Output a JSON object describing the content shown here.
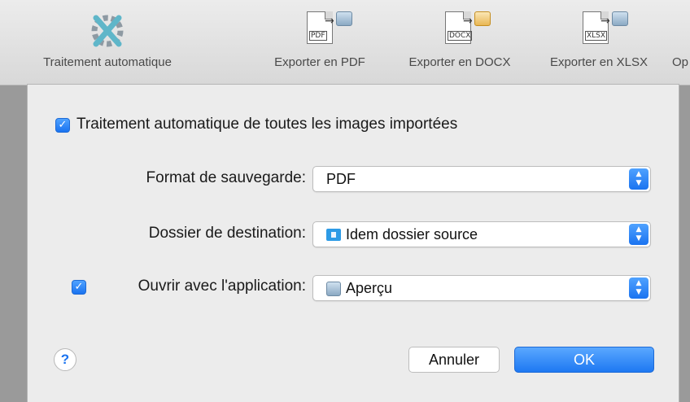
{
  "toolbar": {
    "items": [
      {
        "label": "Traitement automatique",
        "icon": "auto-process-icon"
      },
      {
        "label": "Exporter en PDF",
        "ext": "PDF",
        "icon": "export-pdf-icon"
      },
      {
        "label": "Exporter en DOCX",
        "ext": "DOCX",
        "icon": "export-docx-icon"
      },
      {
        "label": "Exporter en XLSX",
        "ext": "XLSX",
        "icon": "export-xlsx-icon"
      },
      {
        "label": "Op"
      }
    ]
  },
  "dialog": {
    "auto_checkbox_label": "Traitement automatique de toutes les images importées",
    "auto_checked": true,
    "format_label": "Format de sauvegarde:",
    "format_value": "PDF",
    "dest_label": "Dossier de destination:",
    "dest_value": "Idem dossier source",
    "open_label": "Ouvrir avec l'application:",
    "open_checked": true,
    "open_value": "Aperçu",
    "help": "?",
    "cancel": "Annuler",
    "ok": "OK"
  },
  "colors": {
    "accent": "#1a73f0",
    "background": "#ececec"
  }
}
